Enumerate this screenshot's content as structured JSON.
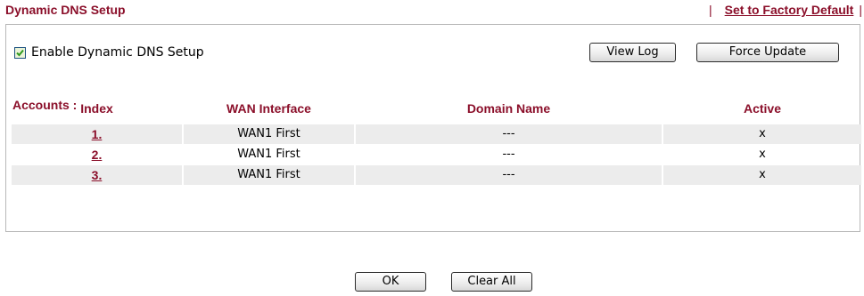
{
  "header": {
    "title": "Dynamic DNS Setup",
    "factory_link": "Set to Factory Default",
    "separator": "|"
  },
  "panel": {
    "enable_label": "Enable Dynamic DNS Setup",
    "enable_checked": true,
    "view_log_label": "View Log",
    "force_update_label": "Force Update"
  },
  "accounts": {
    "heading": "Accounts :",
    "columns": [
      "Index",
      "WAN Interface",
      "Domain Name",
      "Active"
    ],
    "rows": [
      {
        "index": "1.",
        "wan": "WAN1 First",
        "domain": "---",
        "active": "x"
      },
      {
        "index": "2.",
        "wan": "WAN1 First",
        "domain": "---",
        "active": "x"
      },
      {
        "index": "3.",
        "wan": "WAN1 First",
        "domain": "---",
        "active": "x"
      }
    ]
  },
  "footer": {
    "ok_label": "OK",
    "clear_all_label": "Clear All"
  },
  "colors": {
    "accent": "#8b0f2a",
    "row_alt": "#ececec",
    "border": "#b9b9b9"
  }
}
